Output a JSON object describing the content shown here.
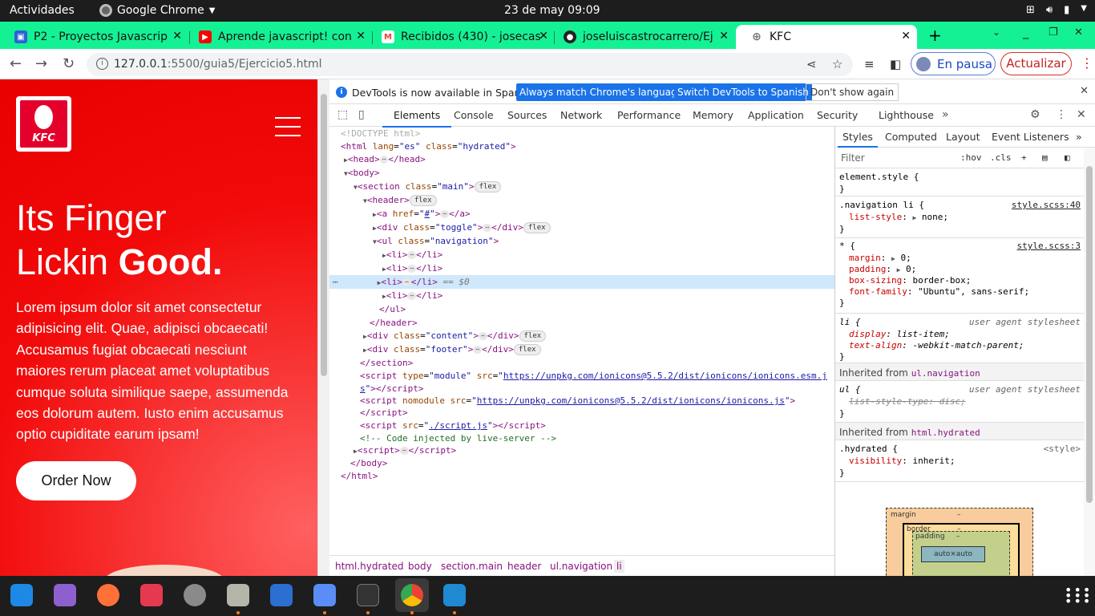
{
  "system": {
    "activities": "Actividades",
    "app_name": "Google Chrome",
    "clock": "23 de may  09:09"
  },
  "tabs": [
    {
      "title": "P2 - Proyectos Javascrip",
      "fav_color": "#2b62d9"
    },
    {
      "title": "Aprende javascript! con",
      "fav_color": "#ff0000"
    },
    {
      "title": "Recibidos (430) - josecas",
      "fav_color": "#ea4335"
    },
    {
      "title": "joseluiscastrocarrero/Ej",
      "fav_color": "#222222"
    },
    {
      "title": "KFC",
      "fav_color": "#777777"
    }
  ],
  "toolbar": {
    "url_host": "127.0.0.1",
    "url_rest": ":5500/guia5/Ejercicio5.html",
    "paused_label": "En pausa",
    "update_label": "Actualizar"
  },
  "page": {
    "logo_text": "KFC",
    "hero_line1": "Its Finger",
    "hero_line2a": "Lickin ",
    "hero_line2b": "Good.",
    "paragraph": "Lorem ipsum dolor sit amet consectetur adipisicing elit. Quae, adipisci obcaecati! Accusamus fugiat obcaecati nesciunt maiores rerum placeat amet voluptatibus cumque soluta similique saepe, assumenda eos dolorum autem. Iusto enim accusamus optio cupiditate earum ipsam!",
    "order_button": "Order Now"
  },
  "devtools": {
    "info_message": "DevTools is now available in Spanish!",
    "btn_match": "Always match Chrome's language",
    "btn_switch": "Switch DevTools to Spanish",
    "btn_dont": "Don't show again",
    "tabs": [
      "Elements",
      "Console",
      "Sources",
      "Network",
      "Performance",
      "Memory",
      "Application",
      "Security",
      "Lighthouse"
    ],
    "breadcrumbs": [
      "html.hydrated",
      "body",
      "section.main",
      "header",
      "ul.navigation",
      "li"
    ],
    "styles_tabs": [
      "Styles",
      "Computed",
      "Layout",
      "Event Listeners"
    ],
    "filter_placeholder": "Filter",
    "filter_hov": ":hov",
    "filter_cls": ".cls",
    "inherited_label": "Inherited from",
    "inherited_1": "ul.navigation",
    "inherited_2": "html.hydrated",
    "box_margin": "margin",
    "box_border": "border",
    "box_padding": "padding",
    "box_dash": "–",
    "box_content": "auto×auto"
  }
}
